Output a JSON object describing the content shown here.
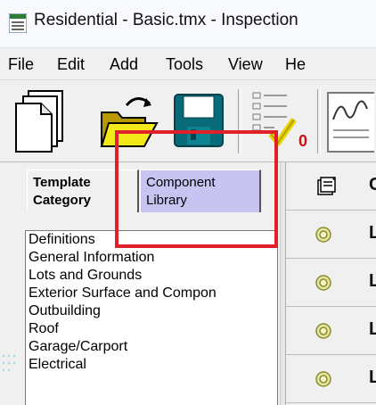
{
  "window": {
    "title": "Residential - Basic.tmx - Inspection"
  },
  "menu": {
    "items": [
      "File",
      "Edit",
      "Add",
      "Tools",
      "View",
      "He"
    ]
  },
  "toolbar": {
    "buttons": [
      "new-document-icon",
      "open-folder-icon",
      "save-icon",
      "checklist-icon",
      "signature-icon"
    ],
    "warning_count": "0"
  },
  "tabs": {
    "template_category": "Template Category",
    "component_library": "Component Library"
  },
  "category_list": [
    "Definitions",
    "General Information",
    "Lots and Grounds",
    "Exterior Surface and Compon",
    "Outbuilding",
    "Roof",
    "Garage/Carport",
    "Electrical"
  ],
  "right_panel": {
    "header_letter": "C",
    "row_letters": [
      "L",
      "L",
      "L",
      "L"
    ]
  },
  "colors": {
    "highlight": "#e0212a",
    "selected_tab": "#c8c4f2"
  }
}
